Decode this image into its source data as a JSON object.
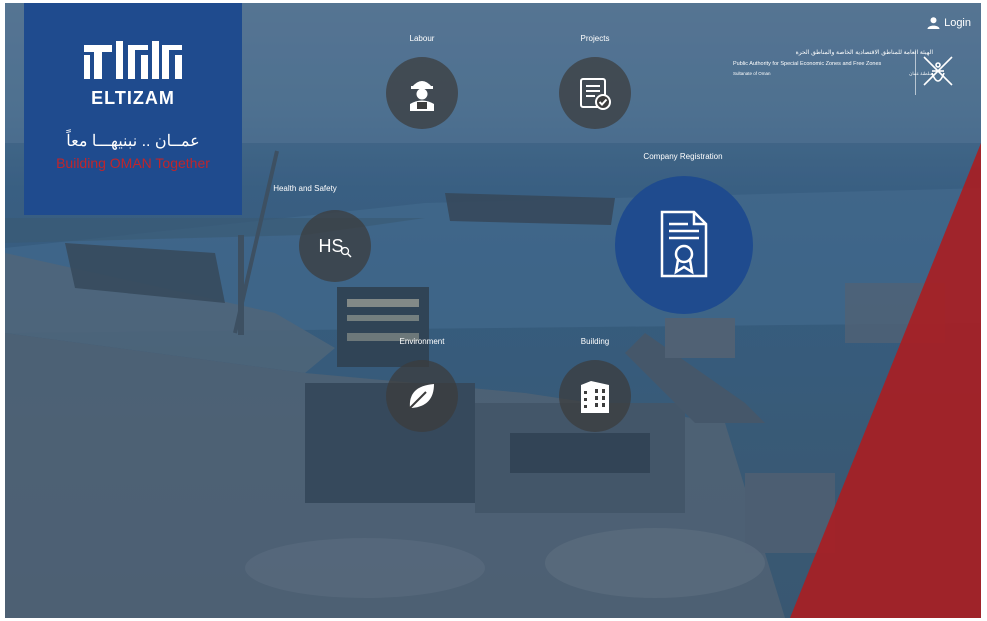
{
  "brand": {
    "logo_word": "ELTIZAM",
    "arabic_tagline": "عمــان .. نبنيهـــا معاً",
    "english_tagline": "Building OMAN Together",
    "colors": {
      "panel": "#1f4b8e",
      "tagline_red": "#c0252b"
    }
  },
  "header": {
    "login_label": "Login",
    "login_icon": "user-icon",
    "authority": {
      "arabic_name": "الهيئة العامة للمناطق الاقتصادية الخاصة والمناطق الحرة",
      "english_name": "Public Authority for Special Economic Zones and Free Zones",
      "sultanate_en": "Sultanate of Oman",
      "sultanate_ar": "سلطنة عمان",
      "emblem_icon": "khanjar-emblem-icon"
    }
  },
  "services": {
    "labour": {
      "label": "Labour",
      "icon": "worker-icon"
    },
    "projects": {
      "label": "Projects",
      "icon": "checklist-icon"
    },
    "company_registration": {
      "label": "Company Registration",
      "icon": "certificate-icon"
    },
    "health_safety": {
      "label": "Health and Safety",
      "icon_text": "HS",
      "icon": "magnifier-icon"
    },
    "environment": {
      "label": "Environment",
      "icon": "leaf-icon"
    },
    "building": {
      "label": "Building",
      "icon": "building-icon"
    }
  },
  "colors": {
    "accent_red": "#a81e23",
    "circle_dark": "#3c3c3c",
    "circle_blue": "#1f4b8e"
  }
}
